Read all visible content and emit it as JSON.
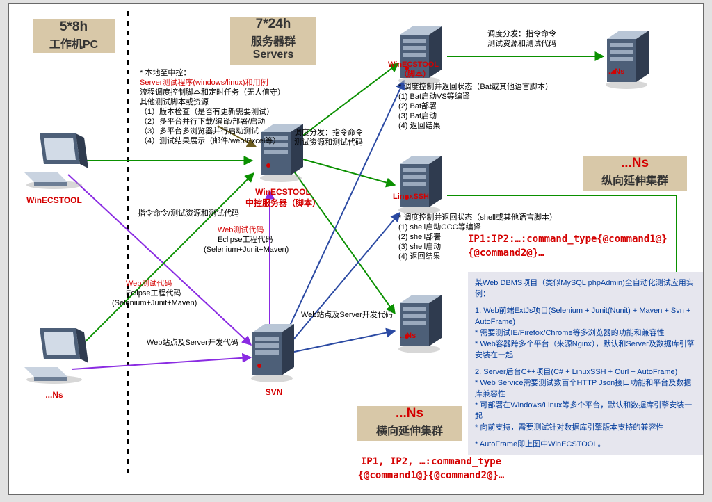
{
  "leftBox": {
    "line1": "5*8h",
    "line2": "工作机PC"
  },
  "topBox": {
    "line1": "7*24h",
    "line2": "服务器群",
    "line3": "Servers"
  },
  "bottomBox": {
    "line1": "...Ns",
    "line2": "横向延伸集群"
  },
  "rightBox": {
    "line1": "...Ns",
    "line2": "纵向延伸集群"
  },
  "pc1": "WinECSTOOL",
  "pc2": "...Ns",
  "ctrl_l1": "WinECSTOOL",
  "ctrl_l2": "中控服务器（脚本）",
  "svn": "SVN",
  "topSrv_l1": "WinECSTOOL",
  "topSrv_l2": "（脚本）",
  "midSrv": "LinuxSSH",
  "botSrv": "...Ns",
  "rightSrvTop": "...Ns",
  "rightSrvBot": "...Ns",
  "local_hdr": "* 本地至中控：",
  "local_red": "Server测试程序(windows/linux)和用例",
  "local_l1": "流程调度控制脚本和定时任务（无人值守）",
  "local_l2": "其他测试脚本或资源",
  "local_l3": "（1）版本检查（是否有更新需要测试）",
  "local_l4": "（2）多平台并行下载/编译/部署/启动",
  "local_l5": "（3）多平台多浏览器并行启动测试",
  "local_l6": "（4）测试结果展示（邮件/web/Excel等）",
  "dispatch_l1": "调度分发：指令命令",
  "dispatch_l2": "测试资源和测试代码",
  "topList_hdr": "* 调度控制并返回状态（Bat或其他语言脚本）",
  "topList_l1": "(1) Bat启动VS等编译",
  "topList_l2": "(2) Bat部署",
  "topList_l3": "(3) Bat启动",
  "topList_l4": "(4) 返回结果",
  "midList_hdr": "* 调度控制并返回状态（shell或其他语言脚本）",
  "midList_l1": "(1) shell启动GCC等编译",
  "midList_l2": "(2) shell部署",
  "midList_l3": "(3) shell启动",
  "midList_l4": "(4) 返回结果",
  "cmdLine": "指令命令/测试资源和测试代码",
  "webtest_hdr": "Web测试代码",
  "webtest_l1": "Eclipse工程代码",
  "webtest_l2": "(Selenium+Junit+Maven)",
  "svn_line": "Web站点及Server开发代码",
  "proto1_l1": "IP1:IP2:…:command_type{@command1@}",
  "proto1_l2": "{@command2@}…",
  "proto2_l1": "IP1, IP2, …:command_type",
  "proto2_l2": "{@command1@}{@command2@}…",
  "note_hd": "某Web DBMS项目（类似MySQL phpAdmin)全自动化测试应用实例：",
  "note_a1": "1.  Web前端ExtJs项目(Selenium + Junit(Nunit) + Maven + Svn + AutoFrame)",
  "note_a2": "* 需要测试IE/Firefox/Chrome等多浏览器的功能和兼容性",
  "note_a3": "* Web容器跨多个平台（来源Nginx），默认和Server及数据库引擎安装在一起",
  "note_b1": "2.  Server后台C++项目(C# + LinuxSSH + Curl + AutoFrame)",
  "note_b2": "* Web Service需要测试数百个HTTP Json接口功能和平台及数据库兼容性",
  "note_b3": "* 可部署在Windows/Linux等多个平台，默认和数据库引擎安装一起",
  "note_b4": "* 向前支持，需要测试针对数据库引擎版本支持的兼容性",
  "note_f": "* AutoFrame即上图中WinECSTOOL。"
}
